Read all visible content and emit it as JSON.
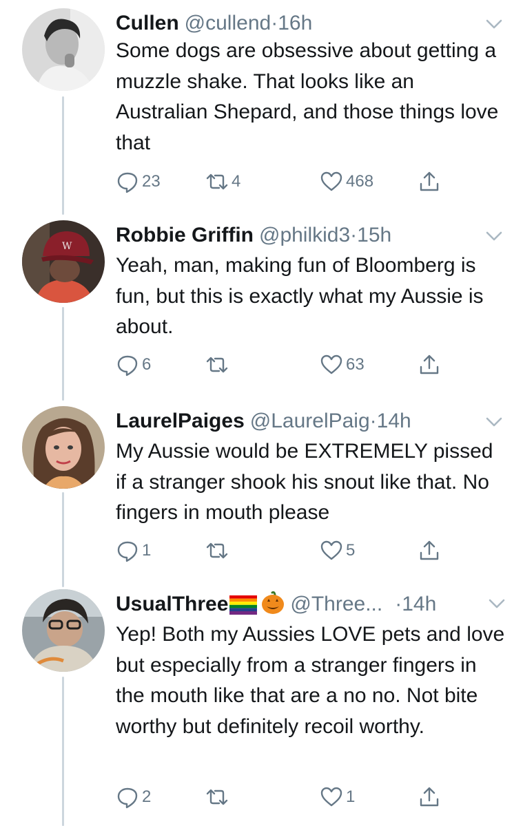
{
  "tweets": [
    {
      "name": "Cullen",
      "handle": "@cullend",
      "dot": "·",
      "time": "16h",
      "text": "Some dogs are obsessive about getting a muzzle shake. That looks like an Australian Shepard, and those things love that",
      "replies": "23",
      "retweets": "4",
      "likes": "468"
    },
    {
      "name": "Robbie Griffin",
      "handle": "@philkid3",
      "dot": "·",
      "time": "15h",
      "text": "Yeah, man, making fun of Bloomberg is fun, but this is exactly what my Aussie is about.",
      "replies": "6",
      "retweets": "",
      "likes": "63"
    },
    {
      "name": "LaurelPaiges",
      "handle": "@LaurelPaig",
      "dot": "·",
      "time": "14h",
      "text": "My Aussie would be EXTREMELY pissed if a stranger shook his snout like that. No fingers in mouth please",
      "replies": "1",
      "retweets": "",
      "likes": "5"
    },
    {
      "name": "UsualThree",
      "name_emojis": [
        "rainbow-flag",
        "jack-o-lantern"
      ],
      "handle": "@Three...",
      "dot": "·",
      "time": "14h",
      "text": "Yep! Both my Aussies LOVE pets and love but especially from a stranger fingers in the mouth like that are a no no. Not bite worthy but definitely recoil worthy.",
      "replies": "2",
      "retweets": "",
      "likes": "1"
    }
  ],
  "colors": {
    "text": "#14171a",
    "secondary": "#657786",
    "thread_line": "#ccd6dd"
  },
  "icons": [
    "reply-icon",
    "retweet-icon",
    "like-icon",
    "share-icon",
    "chevron-down-icon"
  ]
}
